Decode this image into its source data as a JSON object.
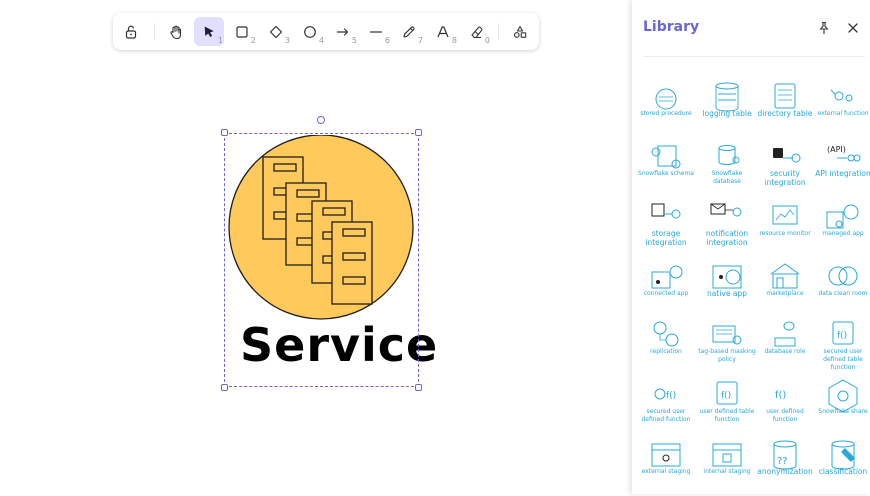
{
  "toolbar": {
    "tools": [
      {
        "name": "lock",
        "num": ""
      },
      {
        "name": "hand",
        "num": ""
      },
      {
        "name": "selection",
        "num": "1"
      },
      {
        "name": "rectangle",
        "num": "2"
      },
      {
        "name": "diamond",
        "num": "3"
      },
      {
        "name": "ellipse",
        "num": "4"
      },
      {
        "name": "arrow",
        "num": "5"
      },
      {
        "name": "line",
        "num": "6"
      },
      {
        "name": "draw",
        "num": "7"
      },
      {
        "name": "text",
        "num": "8"
      },
      {
        "name": "eraser",
        "num": "0"
      },
      {
        "name": "library",
        "num": ""
      }
    ],
    "accent": "#6965db",
    "active_bg": "#e0dfff"
  },
  "canvas": {
    "service_label": "Service",
    "circle_fill": "#ffc95c"
  },
  "library": {
    "title": "Library",
    "icon_color": "#28a8dc",
    "items": [
      {
        "label": "stored procedure"
      },
      {
        "label": "logging table"
      },
      {
        "label": "directory table"
      },
      {
        "label": "external function"
      },
      {
        "label": "Snowflake schema"
      },
      {
        "label": "Snowflake database"
      },
      {
        "label": "security integration"
      },
      {
        "label": "API integration"
      },
      {
        "label": "storage integration"
      },
      {
        "label": "notification integration"
      },
      {
        "label": "resource monitor"
      },
      {
        "label": "managed app"
      },
      {
        "label": "connected app"
      },
      {
        "label": "native app"
      },
      {
        "label": "marketplace"
      },
      {
        "label": "data clean room"
      },
      {
        "label": "replication"
      },
      {
        "label": "tag-based masking policy"
      },
      {
        "label": "database role"
      },
      {
        "label": "secured user defined table function"
      },
      {
        "label": "secured user defined function"
      },
      {
        "label": "user defined table function"
      },
      {
        "label": "user defined function"
      },
      {
        "label": "Snowflake share"
      },
      {
        "label": "external staging"
      },
      {
        "label": "internal staging"
      },
      {
        "label": "anonymization"
      },
      {
        "label": "classification"
      }
    ]
  }
}
